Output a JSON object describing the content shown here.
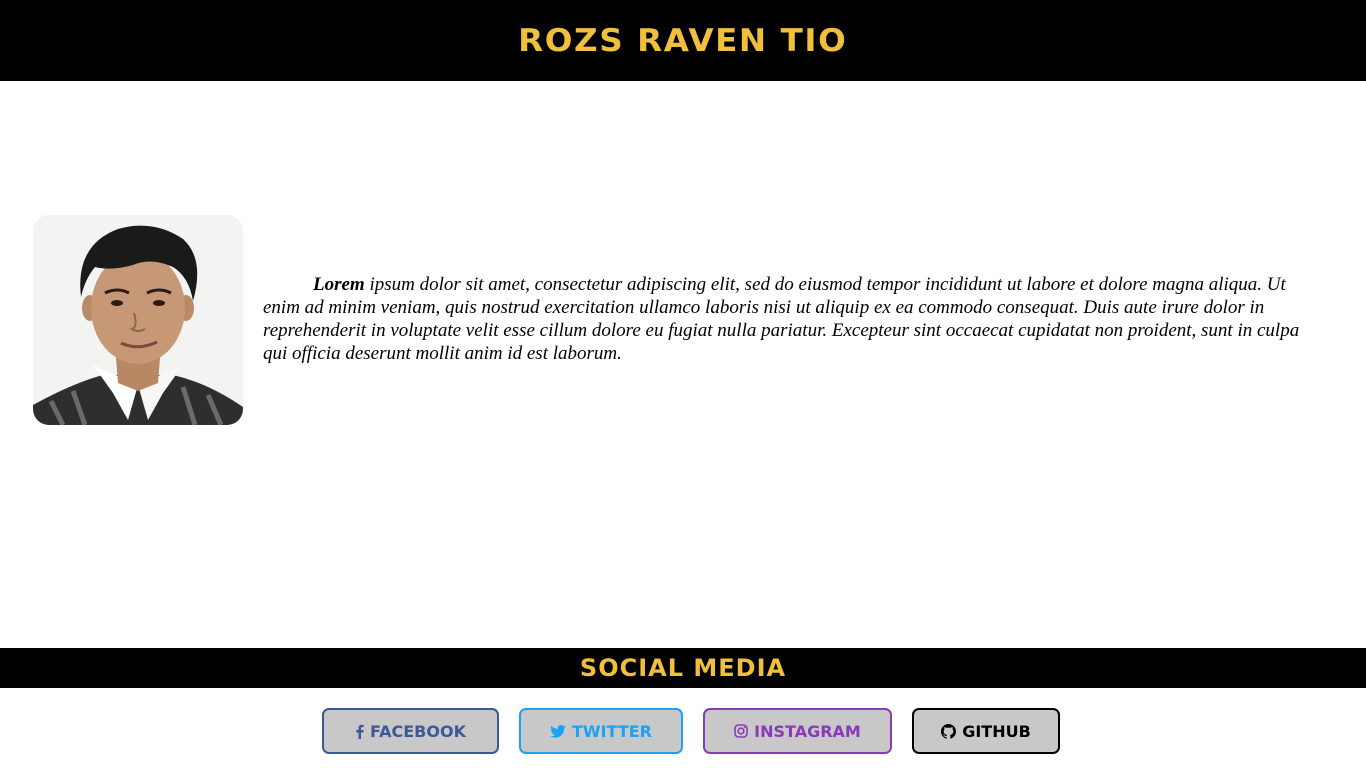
{
  "header": {
    "title": "ROZS RAVEN TIO"
  },
  "profile": {
    "image_subject": "portrait photo of a young man"
  },
  "bio": {
    "lead": "Lorem",
    "text": " ipsum dolor sit amet, consectetur adipiscing elit, sed do eiusmod tempor incididunt ut labore et dolore magna aliqua. Ut enim ad minim veniam, quis nostrud exercitation ullamco laboris nisi ut aliquip ex ea commodo consequat. Duis aute irure dolor in reprehenderit in voluptate velit esse cillum dolore eu fugiat nulla pariatur. Excepteur sint occaecat cupidatat non proident, sunt in culpa qui officia deserunt mollit anim id est laborum."
  },
  "social": {
    "heading": "SOCIAL MEDIA",
    "buttons": [
      {
        "label": "FACEBOOK",
        "icon": "facebook-icon",
        "color": "#3b5998"
      },
      {
        "label": "TWITTER",
        "icon": "twitter-icon",
        "color": "#1da1f2"
      },
      {
        "label": "INSTAGRAM",
        "icon": "instagram-icon",
        "color": "#8a3ab9"
      },
      {
        "label": "GITHUB",
        "icon": "github-icon",
        "color": "#000000"
      }
    ]
  },
  "colors": {
    "accent": "#f0c03c",
    "bar_background": "#000000",
    "button_background": "#c8c8c8"
  }
}
